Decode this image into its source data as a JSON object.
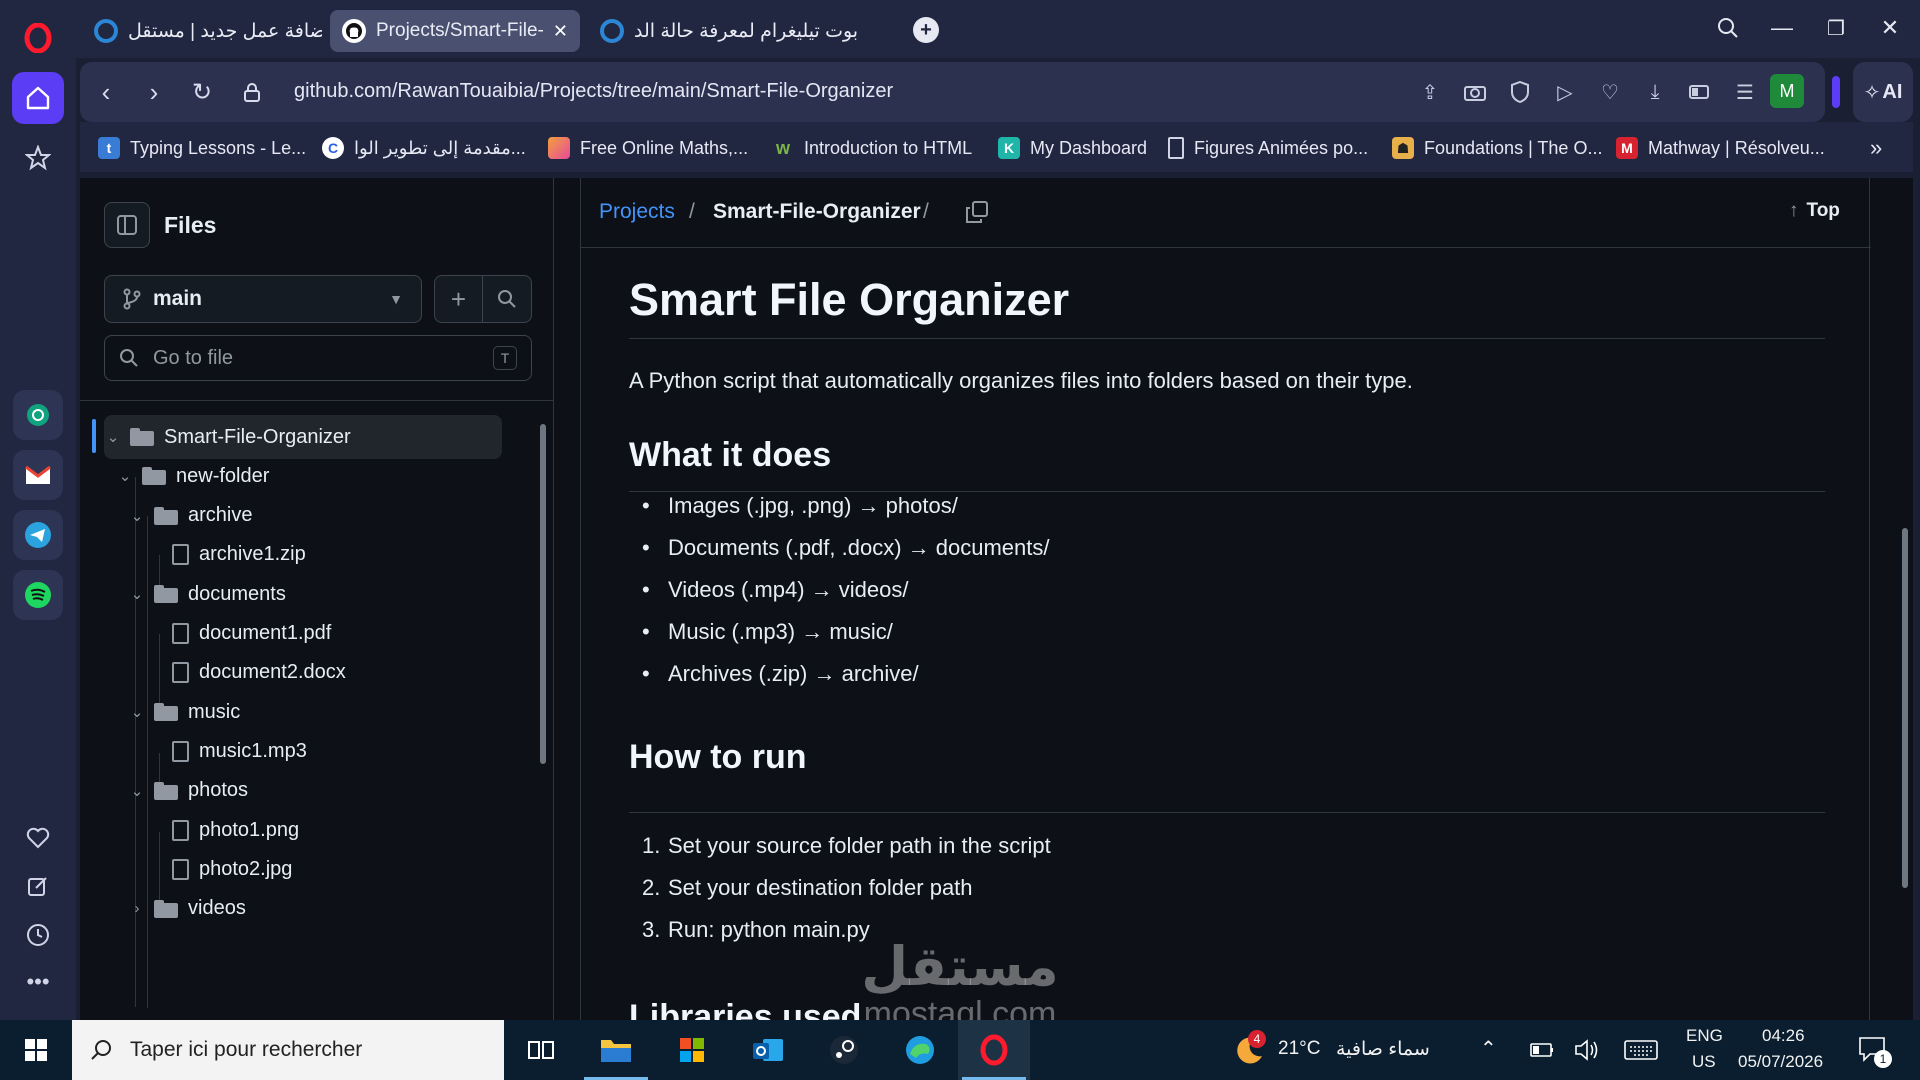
{
  "browser": {
    "tabs": [
      {
        "title": "إضافة عمل جديد | مستقل",
        "active": false
      },
      {
        "title": "Projects/Smart-File-Or",
        "active": true
      },
      {
        "title": "بوت تيليغرام لمعرفة حالة الد",
        "active": false
      }
    ],
    "new_tab_icon": "plus-icon",
    "url": "github.com/RawanTouaibia/Projects/tree/main/Smart-File-Organizer",
    "ai_label": "AI",
    "profile_initial": "M",
    "bookmarks": [
      {
        "label": "Typing Lessons - Le...",
        "icon_color": "#3a7bd5"
      },
      {
        "label": "مقدمة إلى تطوير الوا...",
        "icon_color": "#ffffff"
      },
      {
        "label": "Free Online Maths,...",
        "icon_color": "#e84a9a"
      },
      {
        "label": "Introduction to HTML",
        "icon_color": "#7ab648"
      },
      {
        "label": "My Dashboard",
        "icon_color": "#1fb5a8"
      },
      {
        "label": "Figures Animées po...",
        "icon_color": "#d0d4e6"
      },
      {
        "label": "Foundations | The O...",
        "icon_color": "#e8b04a"
      },
      {
        "label": "Mathway | Résolveu...",
        "icon_color": "#d6232f"
      }
    ]
  },
  "files_panel": {
    "title": "Files",
    "branch": "main",
    "search_placeholder": "Go to file",
    "search_shortcut": "T",
    "tree": [
      {
        "name": "Smart-File-Organizer",
        "type": "folder",
        "depth": 0,
        "expanded": true,
        "selected": true
      },
      {
        "name": "new-folder",
        "type": "folder",
        "depth": 1,
        "expanded": true
      },
      {
        "name": "archive",
        "type": "folder",
        "depth": 2,
        "expanded": true
      },
      {
        "name": "archive1.zip",
        "type": "file",
        "depth": 3
      },
      {
        "name": "documents",
        "type": "folder",
        "depth": 2,
        "expanded": true
      },
      {
        "name": "document1.pdf",
        "type": "file",
        "depth": 3
      },
      {
        "name": "document2.docx",
        "type": "file",
        "depth": 3
      },
      {
        "name": "music",
        "type": "folder",
        "depth": 2,
        "expanded": true
      },
      {
        "name": "music1.mp3",
        "type": "file",
        "depth": 3
      },
      {
        "name": "photos",
        "type": "folder",
        "depth": 2,
        "expanded": true
      },
      {
        "name": "photo1.png",
        "type": "file",
        "depth": 3
      },
      {
        "name": "photo2.jpg",
        "type": "file",
        "depth": 3
      },
      {
        "name": "videos",
        "type": "folder",
        "depth": 2,
        "expanded": false
      }
    ]
  },
  "breadcrumb": {
    "root": "Projects",
    "separator": "/",
    "current": "Smart-File-Organizer",
    "top_label": "Top"
  },
  "readme": {
    "title": "Smart File Organizer",
    "description": "A Python script that automatically organizes files into folders based on their type.",
    "what_heading": "What it does",
    "what_items": [
      "Images (.jpg, .png) → photos/",
      "Documents (.pdf, .docx) → documents/",
      "Videos (.mp4) → videos/",
      "Music (.mp3) → music/",
      "Archives (.zip) → archive/"
    ],
    "run_heading": "How to run",
    "run_steps": [
      "Set your source folder path in the script",
      "Set your destination folder path",
      "Run: python main.py"
    ],
    "libs_heading": "Libraries used"
  },
  "watermark": {
    "line1": "مستقل",
    "line2": "mostaql.com"
  },
  "taskbar": {
    "search_placeholder": "Taper ici pour rechercher",
    "weather_temp": "21°C",
    "weather_desc": "سماء صافية",
    "weather_badge": "4",
    "lang_top": "ENG",
    "lang_bottom": "US",
    "time": "04:26",
    "date": "05/07/2026",
    "notifications": "1"
  }
}
